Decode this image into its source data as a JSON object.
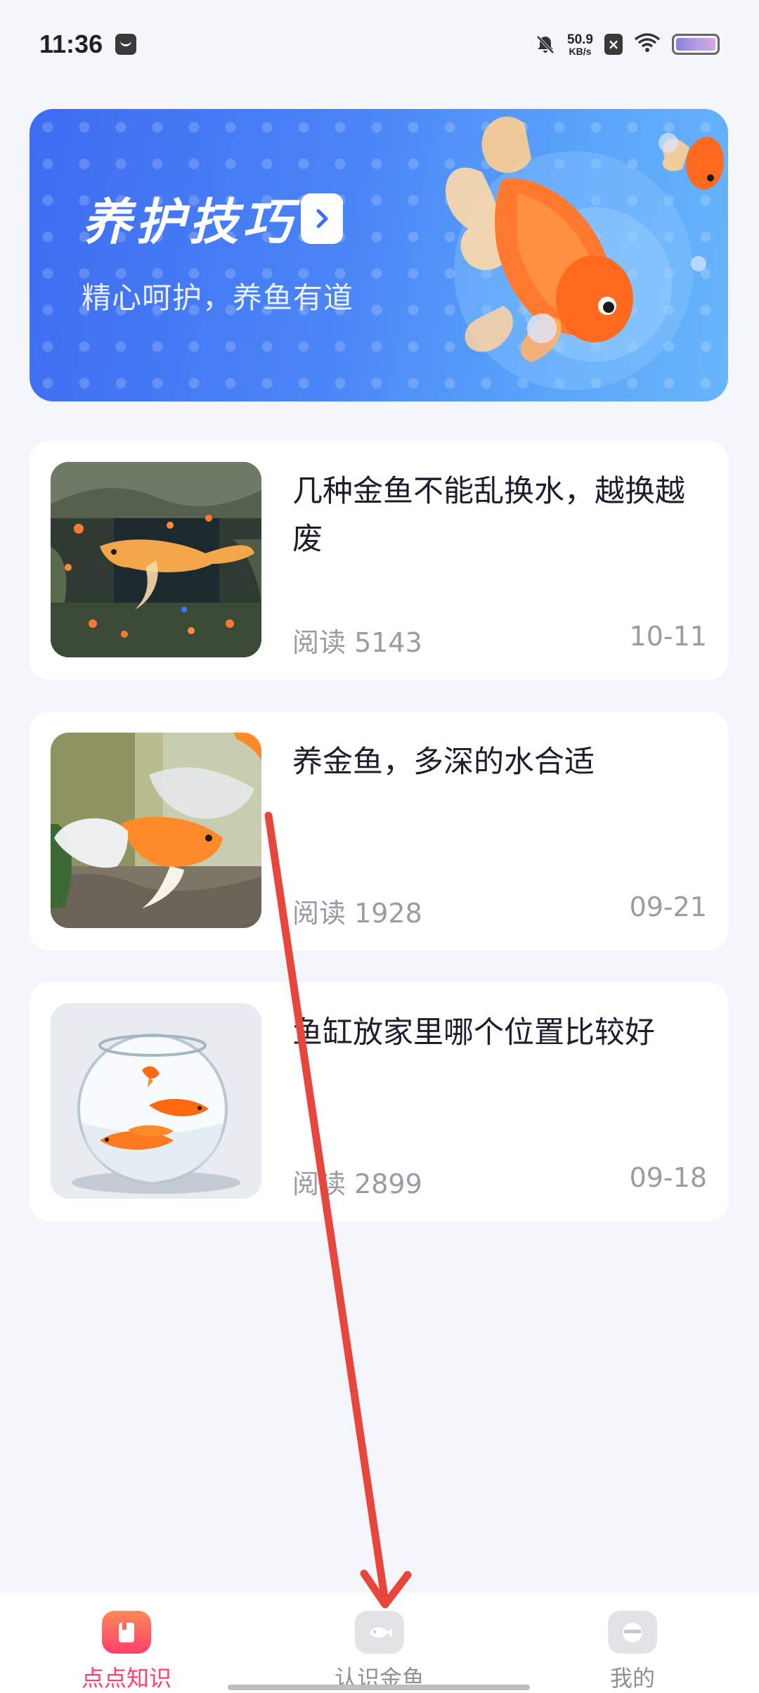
{
  "status_bar": {
    "time": "11:36",
    "speed_value": "50.9",
    "speed_unit": "KB/s"
  },
  "banner": {
    "title": "养护技巧",
    "subtitle": "精心呵护，养鱼有道"
  },
  "articles": [
    {
      "title": "几种金鱼不能乱换水，越换越废",
      "read": "阅读 5143",
      "date": "10-11"
    },
    {
      "title": "养金鱼，多深的水合适",
      "read": "阅读 1928",
      "date": "09-21"
    },
    {
      "title": "鱼缸放家里哪个位置比较好",
      "read": "阅读 2899",
      "date": "09-18"
    }
  ],
  "bottom_nav": {
    "items": [
      {
        "label": "点点知识",
        "icon": "book-icon",
        "active": true
      },
      {
        "label": "认识金鱼",
        "icon": "fish-icon",
        "active": false
      },
      {
        "label": "我的",
        "icon": "profile-icon",
        "active": false
      }
    ]
  },
  "colors": {
    "accent": "#ff3f6e",
    "banner_blue": "#4a85f7",
    "annotation_red": "#e8453c"
  }
}
